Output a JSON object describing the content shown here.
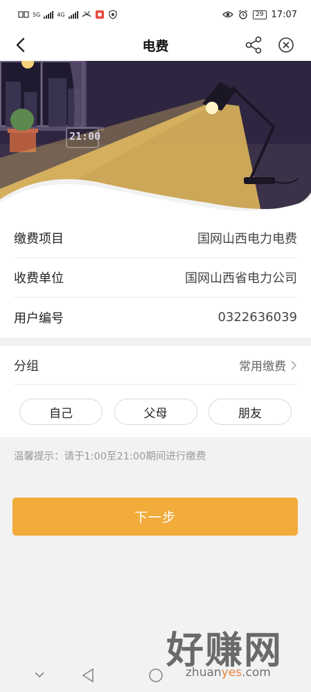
{
  "status_bar": {
    "left_icons": [
      "sim1-icon",
      "signal-5g-icon",
      "signal-4g-icon",
      "missed-call-icon",
      "app-notification-icon",
      "shield-notification-icon"
    ],
    "sim_label": "5G",
    "sim2_label": "4G",
    "battery": "29",
    "time": "17:07"
  },
  "nav": {
    "title": "电费",
    "back_icon": "chevron-left-icon",
    "share_icon": "share-icon",
    "close_icon": "close-circle-icon"
  },
  "banner": {
    "clock_text": "21:00"
  },
  "info": {
    "rows": [
      {
        "label": "缴费项目",
        "value": "国网山西电力电费"
      },
      {
        "label": "收费单位",
        "value": "国网山西省电力公司"
      },
      {
        "label": "用户编号",
        "value": "0322636039"
      }
    ]
  },
  "group": {
    "label": "分组",
    "value": "常用缴费",
    "chips": [
      "自己",
      "父母",
      "朋友"
    ]
  },
  "tip": "温馨提示：请于1:00至21:00期间进行缴费",
  "next_button": "下一步",
  "watermark": {
    "title": "好赚网",
    "url_a": "zhuan",
    "url_b": "yes",
    "url_c": ".com"
  },
  "colors": {
    "accent": "#f1ac3b",
    "banner_bg": "#3b3148",
    "lamp_light": "#d9b15a"
  }
}
